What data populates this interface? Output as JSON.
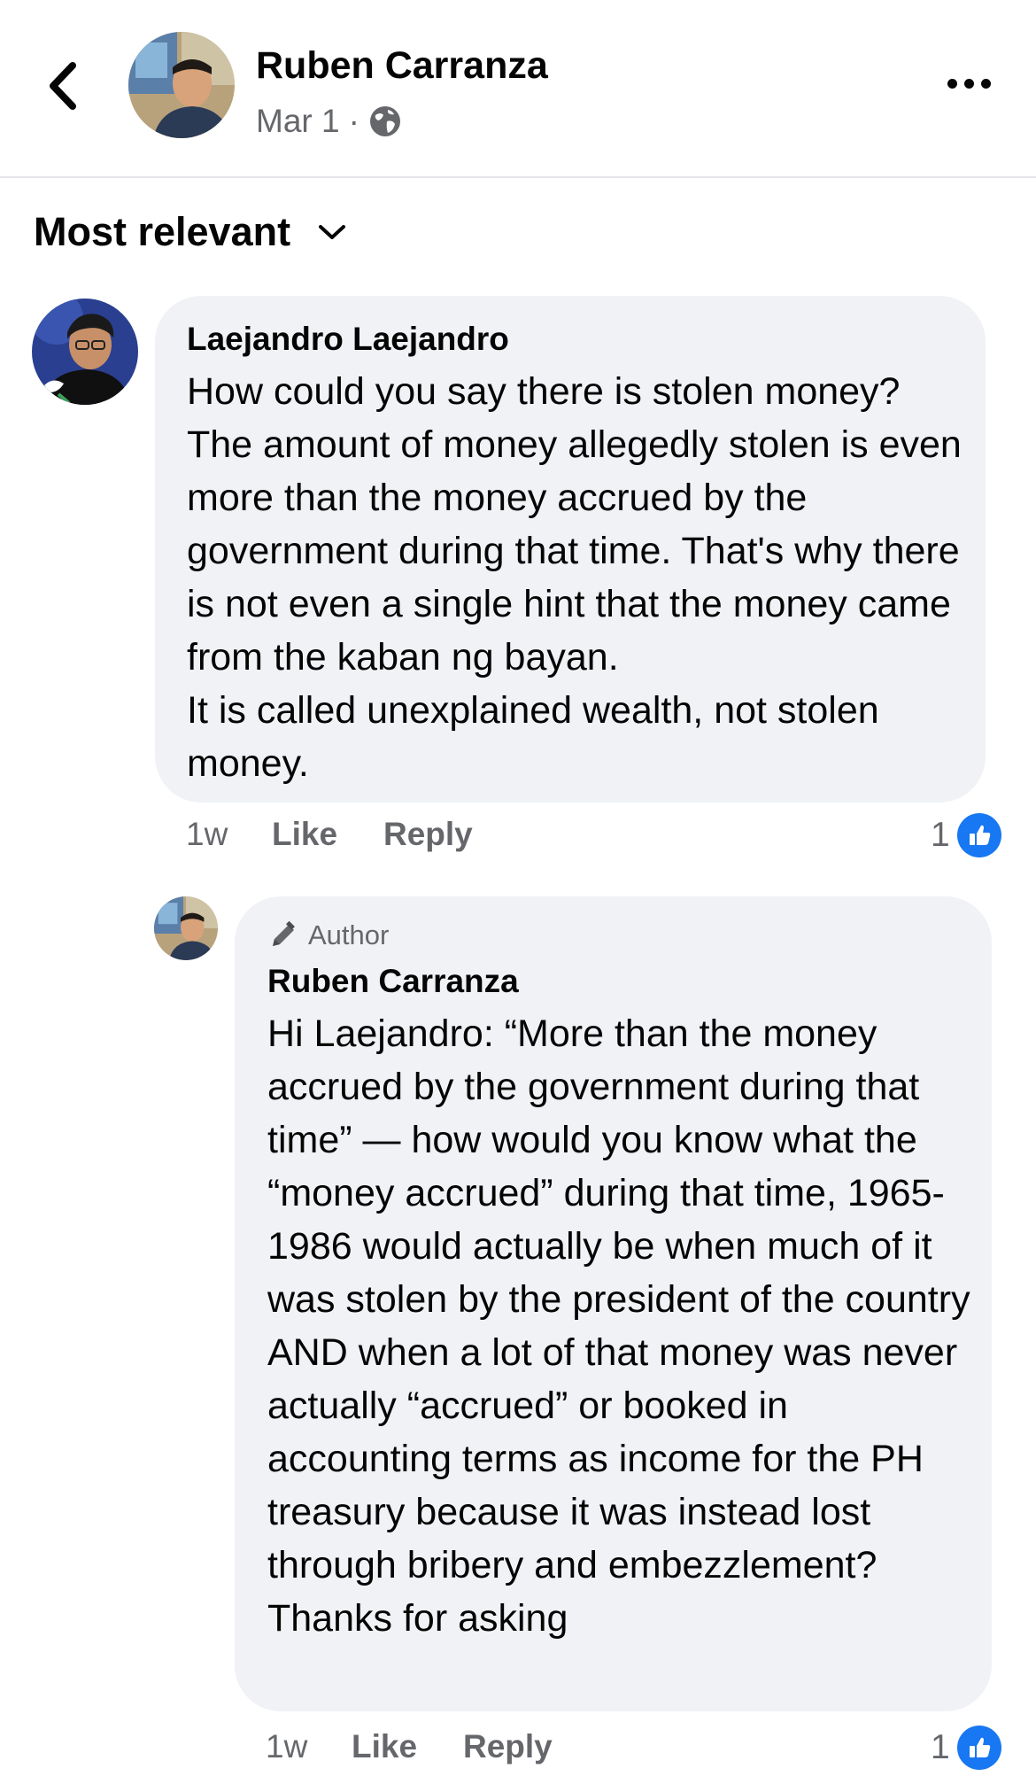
{
  "header": {
    "author_name": "Ruben Carranza",
    "date": "Mar 1",
    "separator": "·",
    "privacy_icon": "globe-icon",
    "back_icon": "chevron-left-icon",
    "more_icon": "more-horizontal-icon"
  },
  "sort": {
    "label": "Most relevant",
    "icon": "chevron-down-icon"
  },
  "comments": [
    {
      "author": "Laejandro Laejandro",
      "paragraphs": [
        "How could you say there is stolen money? The amount of money allegedly stolen is even more than the money accrued by the government during that time. That's why there is not even a single hint that the money came from the kaban ng bayan.",
        "It is called unexplained wealth, not stolen money."
      ],
      "time": "1w",
      "like_label": "Like",
      "reply_label": "Reply",
      "reaction_count": "1",
      "reaction_icon": "like-icon"
    },
    {
      "author": "Ruben Carranza",
      "badge": "Author",
      "badge_icon": "pencil-icon",
      "paragraphs": [
        "Hi Laejandro: “More than the money accrued by the government during that time” — how would you know what the “money accrued” during that time, 1965-1986 would actually be when much of it was stolen by the president of the country AND when a lot of that money was never actually “accrued” or booked in accounting terms as income for the PH treasury because it was instead lost through bribery and embezzlement? Thanks for asking"
      ],
      "time": "1w",
      "like_label": "Like",
      "reply_label": "Reply",
      "reaction_count": "1",
      "reaction_icon": "like-icon"
    }
  ],
  "colors": {
    "accent": "#1877f2",
    "bubble": "#f0f2f5",
    "secondary_text": "#65676b"
  }
}
